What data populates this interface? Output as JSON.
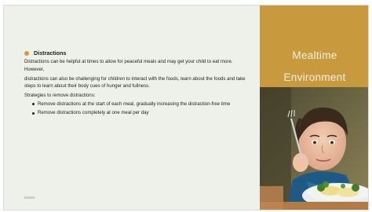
{
  "slide": {
    "title_line1": "Mealtime",
    "title_line2": "Environment",
    "heading": "Distractions",
    "paragraph1": "Distractions can be helpful at times to allow for peaceful meals and may get your child to eat more. However,",
    "paragraph2": "distractions can also be challenging for children to interact with the foods, learn about the foods and take steps to learn about their body cues of hunger and fullness.",
    "strategies_label": "Strategies to remove distractions:",
    "strategies": [
      "Remove distractions at the start of each meal, gradually increasing the distraction-free time",
      "Remove distractions completely at one meal per day"
    ],
    "date": "5/28/24",
    "photo_icon": "child-eating-photo",
    "colors": {
      "accent": "#c89a3d",
      "background": "#eef1ea",
      "bullet": "#d99a34"
    }
  }
}
